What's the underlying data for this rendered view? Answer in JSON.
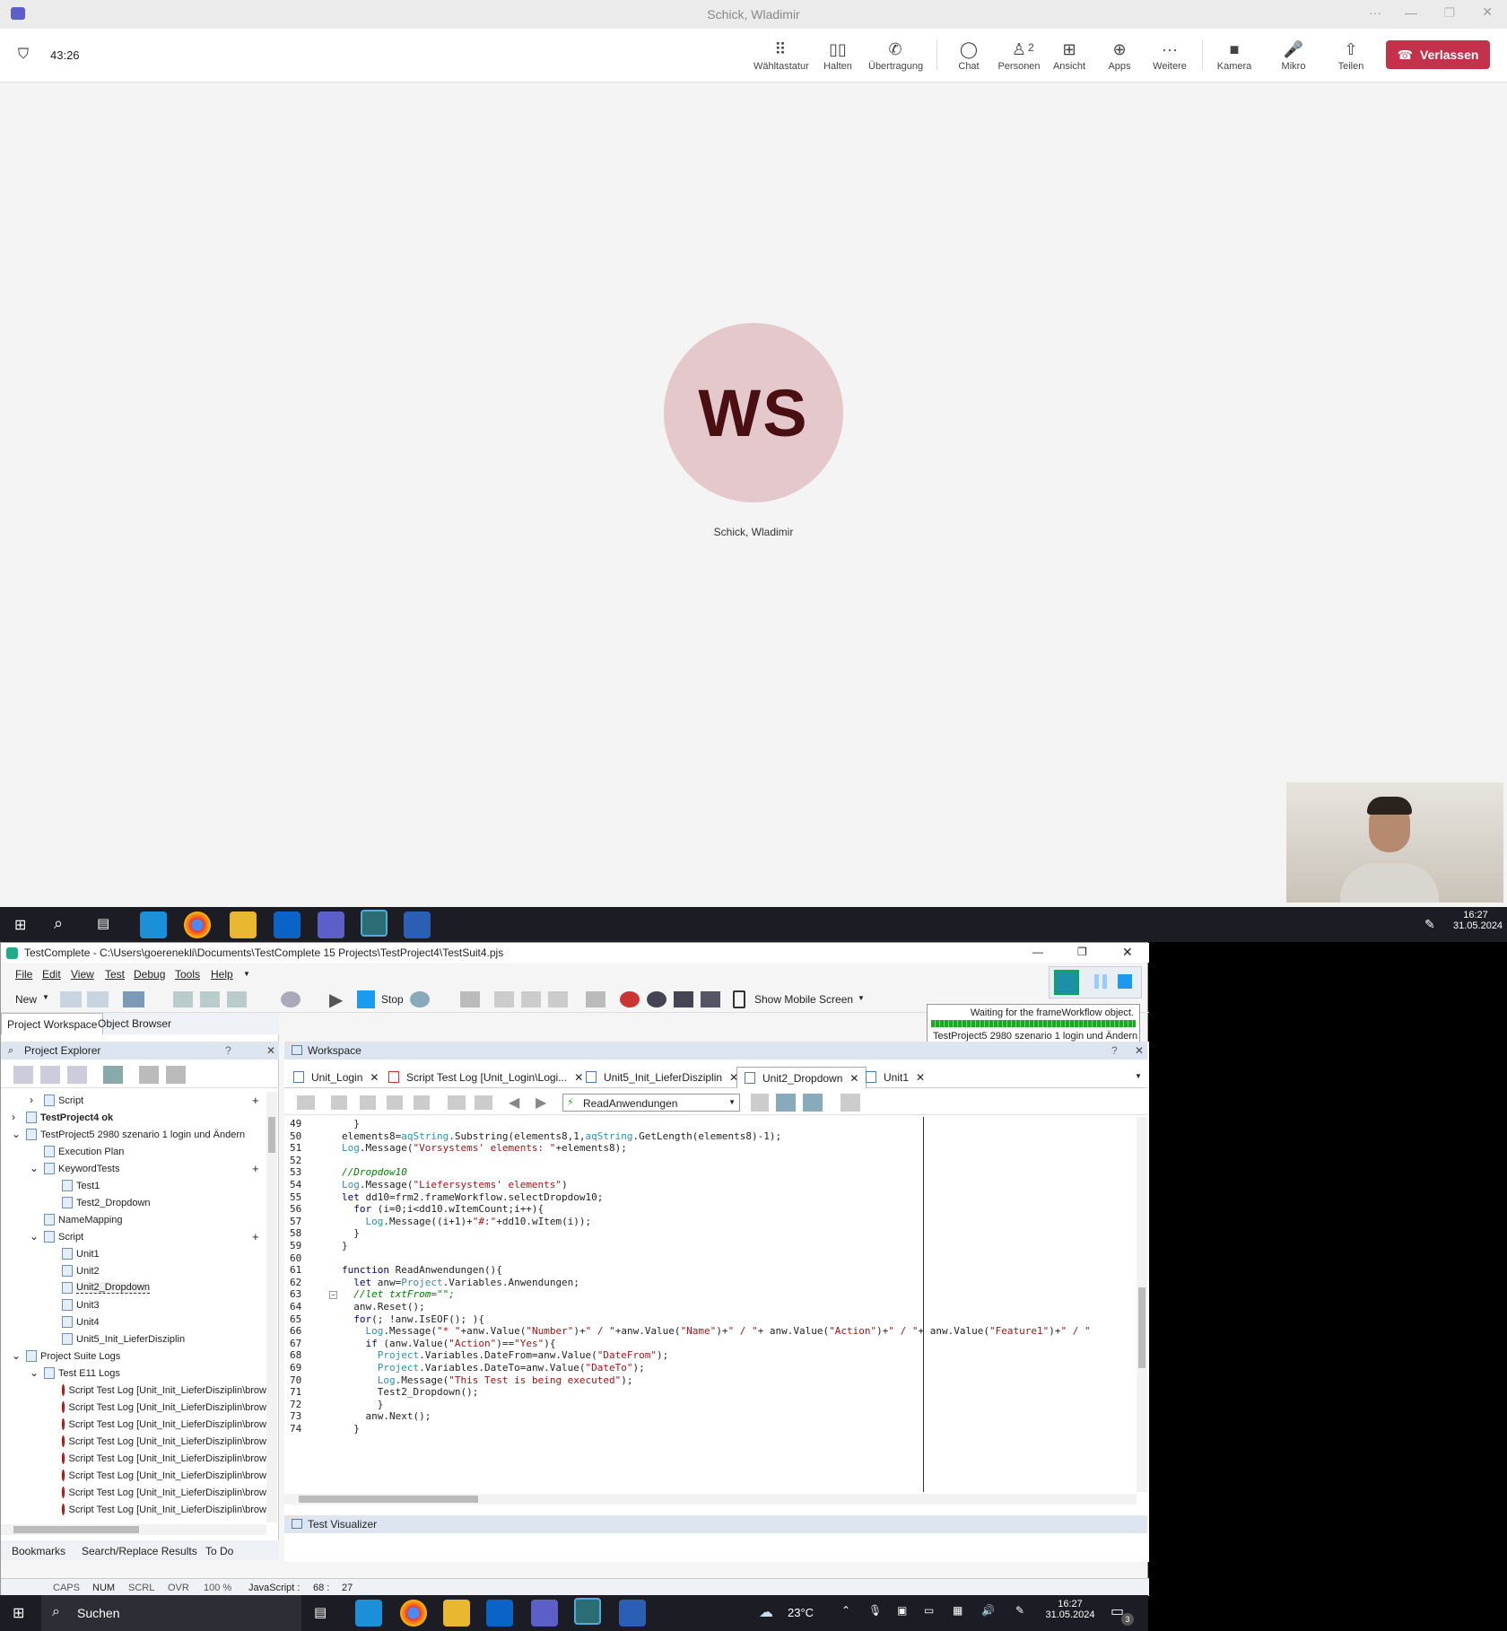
{
  "teams": {
    "window_title": "Schick, Wladimir",
    "timer": "43:26",
    "toolbar": [
      {
        "label": "Wähltastatur",
        "icon": "dialpad-icon"
      },
      {
        "label": "Halten",
        "icon": "pause-icon"
      },
      {
        "label": "Übertragung",
        "icon": "transfer-icon"
      },
      {
        "label": "Chat",
        "icon": "chat-icon"
      },
      {
        "label": "Personen",
        "icon": "people-icon",
        "count": "2"
      },
      {
        "label": "Ansicht",
        "icon": "grid-icon"
      },
      {
        "label": "Apps",
        "icon": "apps-icon"
      },
      {
        "label": "Weitere",
        "icon": "more-icon"
      },
      {
        "label": "Kamera",
        "icon": "camera-icon"
      },
      {
        "label": "Mikro",
        "icon": "mic-icon"
      },
      {
        "label": "Teilen",
        "icon": "share-icon"
      }
    ],
    "leave_label": "Verlassen",
    "participant_initials": "WS",
    "participant_name": "Schick, Wladimir"
  },
  "remote_taskbar": {
    "time": "16:27",
    "date": "31.05.2024"
  },
  "testcomplete": {
    "title": "TestComplete - C:\\Users\\goerenekli\\Documents\\TestComplete 15 Projects\\TestProject4\\TestSuit4.pjs",
    "menu": [
      "File",
      "Edit",
      "View",
      "Test",
      "Debug",
      "Tools",
      "Help"
    ],
    "toolbar": {
      "new": "New",
      "stop": "Stop",
      "mobile": "Show Mobile Screen"
    },
    "notification": {
      "line1": "Waiting for the frameWorkflow object.",
      "line2": "TestProject5 2980 szenario 1 login und Ändern"
    },
    "left_tabs": [
      "Project Workspace",
      "Object Browser"
    ],
    "explorer_title": "Project Explorer",
    "tree": [
      {
        "label": "Script",
        "indent": 3,
        "icon": "folder"
      },
      {
        "label": "TestProject4 ok",
        "indent": 1,
        "icon": "project",
        "bold": true
      },
      {
        "label": "TestProject5 2980 szenario 1 login und Ändern",
        "indent": 1,
        "icon": "project"
      },
      {
        "label": "Execution Plan",
        "indent": 3,
        "icon": "item"
      },
      {
        "label": "KeywordTests",
        "indent": 3,
        "icon": "folder"
      },
      {
        "label": "Test1",
        "indent": 5,
        "icon": "item"
      },
      {
        "label": "Test2_Dropdown",
        "indent": 5,
        "icon": "item"
      },
      {
        "label": "NameMapping",
        "indent": 3,
        "icon": "item"
      },
      {
        "label": "Script",
        "indent": 3,
        "icon": "folder"
      },
      {
        "label": "Unit1",
        "indent": 5,
        "icon": "item"
      },
      {
        "label": "Unit2",
        "indent": 5,
        "icon": "item"
      },
      {
        "label": "Unit2_Dropdown",
        "indent": 5,
        "icon": "item",
        "selected": true
      },
      {
        "label": "Unit3",
        "indent": 5,
        "icon": "item"
      },
      {
        "label": "Unit4",
        "indent": 5,
        "icon": "item"
      },
      {
        "label": "Unit5_Init_LieferDisziplin",
        "indent": 5,
        "icon": "item"
      },
      {
        "label": "Project Suite Logs",
        "indent": 1,
        "icon": "folder"
      },
      {
        "label": "Test E11 Logs",
        "indent": 3,
        "icon": "folder"
      },
      {
        "label": "Script Test Log [Unit_Init_LieferDisziplin\\brow",
        "indent": 5,
        "icon": "red"
      },
      {
        "label": "Script Test Log [Unit_Init_LieferDisziplin\\brow",
        "indent": 5,
        "icon": "red"
      },
      {
        "label": "Script Test Log [Unit_Init_LieferDisziplin\\brow",
        "indent": 5,
        "icon": "red"
      },
      {
        "label": "Script Test Log [Unit_Init_LieferDisziplin\\brow",
        "indent": 5,
        "icon": "red"
      },
      {
        "label": "Script Test Log [Unit_Init_LieferDisziplin\\brow",
        "indent": 5,
        "icon": "red"
      },
      {
        "label": "Script Test Log [Unit_Init_LieferDisziplin\\brow",
        "indent": 5,
        "icon": "red"
      },
      {
        "label": "Script Test Log [Unit_Init_LieferDisziplin\\brow",
        "indent": 5,
        "icon": "red"
      },
      {
        "label": "Script Test Log [Unit_Init_LieferDisziplin\\brow",
        "indent": 5,
        "icon": "red"
      }
    ],
    "bottom_tabs": [
      "Bookmarks",
      "Search/Replace Results",
      "To Do"
    ],
    "workspace_title": "Workspace",
    "editor_tabs": [
      "Unit_Login",
      "Script Test Log [Unit_Login\\Logi...",
      "Unit5_Init_LieferDisziplin",
      "Unit2_Dropdown",
      "Unit1"
    ],
    "routine": "ReadAnwendungen",
    "code": [
      {
        "n": "49",
        "t": "  }"
      },
      {
        "n": "50",
        "t": "elements8=aqString.Substring(elements8,1,aqString.GetLength(elements8)-1);"
      },
      {
        "n": "51",
        "t": "Log.Message(\"Vorsystems' elements: \"+elements8);"
      },
      {
        "n": "52",
        "t": ""
      },
      {
        "n": "53",
        "t": "//Dropdow10"
      },
      {
        "n": "54",
        "t": "Log.Message(\"Liefersystems' elements\")"
      },
      {
        "n": "55",
        "t": "let dd10=frm2.frameWorkflow.selectDropdow10;"
      },
      {
        "n": "56",
        "t": "  for (i=0;i<dd10.wItemCount;i++){"
      },
      {
        "n": "57",
        "t": "    Log.Message((i+1)+\"#:\"+dd10.wItem(i));"
      },
      {
        "n": "58",
        "t": "  }"
      },
      {
        "n": "59",
        "t": "}"
      },
      {
        "n": "60",
        "t": ""
      },
      {
        "n": "61",
        "t": "function ReadAnwendungen(){"
      },
      {
        "n": "62",
        "t": "  let anw=Project.Variables.Anwendungen;"
      },
      {
        "n": "63",
        "t": "  //let txtFrom=\"\";"
      },
      {
        "n": "64",
        "t": "  anw.Reset();"
      },
      {
        "n": "65",
        "t": "  for(; !anw.IsEOF(); ){"
      },
      {
        "n": "66",
        "t": "    Log.Message(\"* \"+anw.Value(\"Number\")+\" / \"+anw.Value(\"Name\")+\" / \"+ anw.Value(\"Action\")+\" / \"+ anw.Value(\"Feature1\")+\" / \""
      },
      {
        "n": "67",
        "t": "    if (anw.Value(\"Action\")==\"Yes\"){"
      },
      {
        "n": "68",
        "t": "      Project.Variables.DateFrom=anw.Value(\"DateFrom\");"
      },
      {
        "n": "69",
        "t": "      Project.Variables.DateTo=anw.Value(\"DateTo\");"
      },
      {
        "n": "70",
        "t": "      Log.Message(\"This Test is being executed\");"
      },
      {
        "n": "71",
        "t": "      Test2_Dropdown();"
      },
      {
        "n": "72",
        "t": "      }"
      },
      {
        "n": "73",
        "t": "    anw.Next();"
      },
      {
        "n": "74",
        "t": "  }"
      }
    ],
    "visualizer": "Test Visualizer",
    "status": [
      "CAPS",
      "NUM",
      "SCRL",
      "OVR",
      "100 %",
      "JavaScript :",
      "68 :",
      "27"
    ]
  },
  "local_taskbar": {
    "search": "Suchen",
    "weather": "23°C",
    "time": "16:27",
    "date": "31.05.2024",
    "badge": "3"
  }
}
